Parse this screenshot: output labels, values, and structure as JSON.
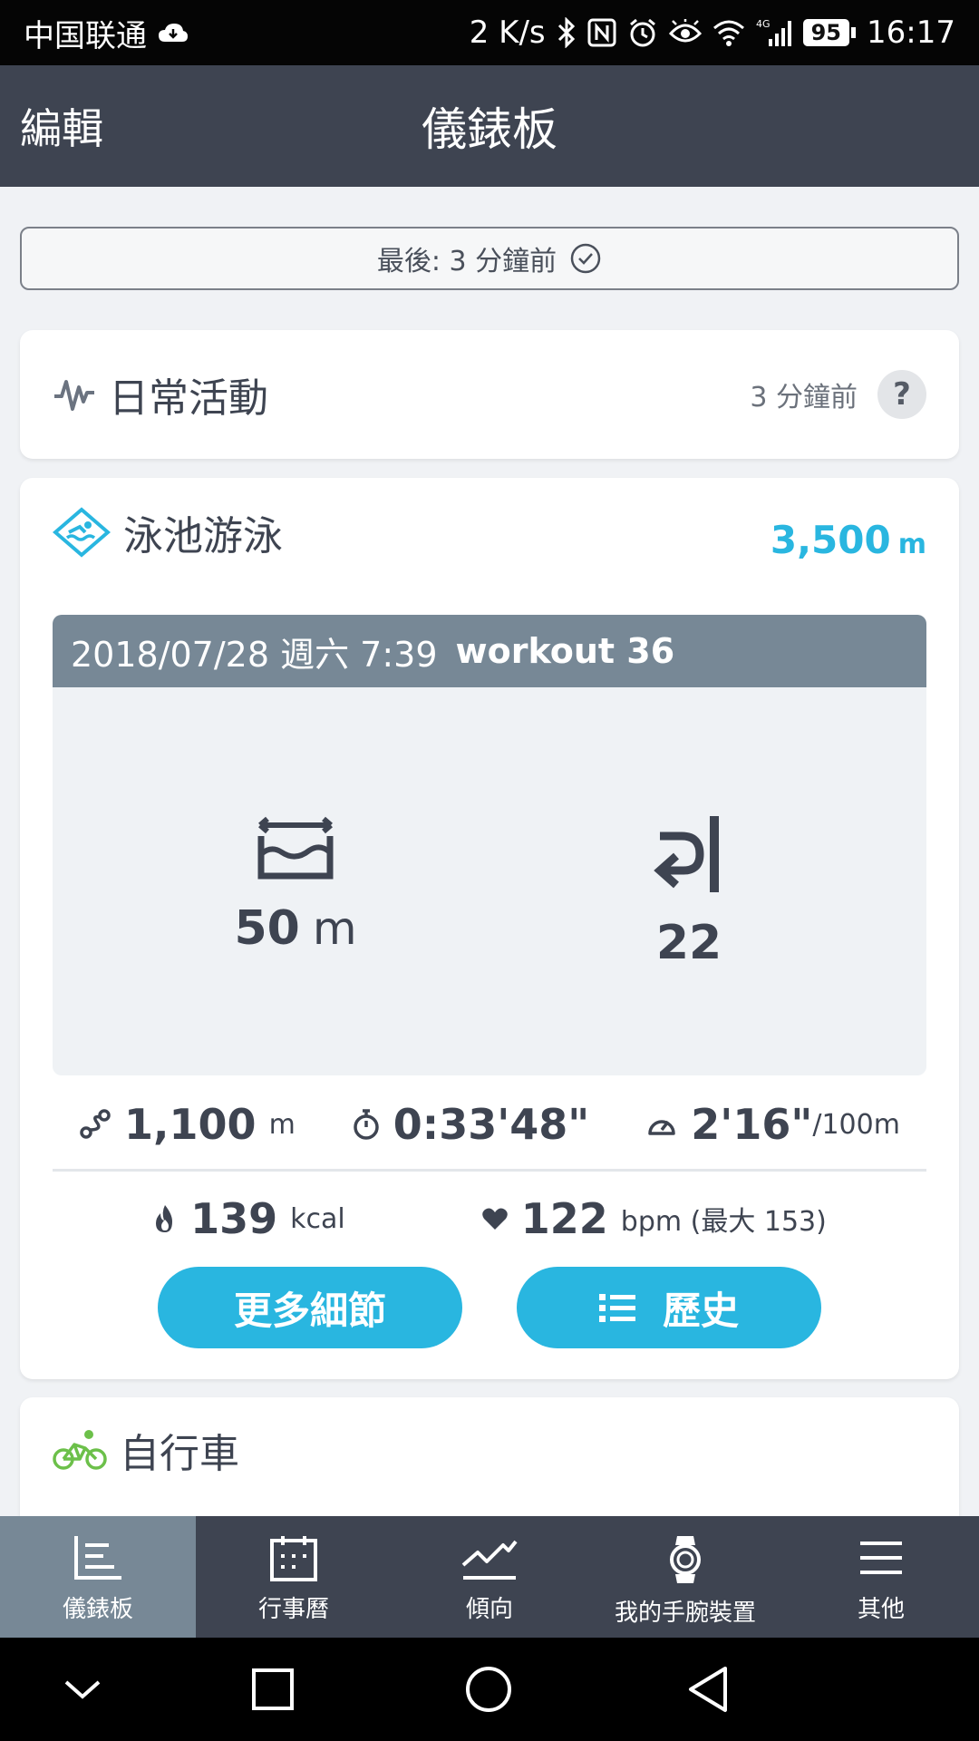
{
  "status_bar": {
    "carrier": "中国联通",
    "net_speed": "2 K/s",
    "network_type": "4G",
    "battery": "95",
    "time": "16:17"
  },
  "header": {
    "edit_label": "編輯",
    "title": "儀錶板"
  },
  "sync": {
    "label": "最後: 3 分鐘前",
    "icon": "check-circle-icon"
  },
  "daily_activity": {
    "title": "日常活動",
    "updated": "3 分鐘前",
    "help": "?",
    "icon": "activity-wave-icon"
  },
  "swim_card": {
    "title": "泳池游泳",
    "icon": "pool-swim-icon",
    "distance_value": "3,500",
    "distance_unit": "m",
    "workout": {
      "date": "2018/07/28 週六 7:39",
      "name": "workout 36",
      "pool_length_value": "50",
      "pool_length_unit": "m",
      "laps": "22"
    },
    "stats": {
      "distance_value": "1,100",
      "distance_unit": "m",
      "duration": "0:33'48\"",
      "pace_value": "2'16\"",
      "pace_unit": "/100m",
      "calories_value": "139",
      "calories_unit": "kcal",
      "heart_rate_value": "122",
      "heart_rate_unit": "bpm (最大 153)"
    },
    "more_button": "更多細節",
    "history_button": "歷史"
  },
  "bike_card": {
    "title": "自行車",
    "icon": "bicycle-icon"
  },
  "bottom_nav": [
    {
      "label": "儀錶板",
      "icon": "dashboard-icon",
      "active": true
    },
    {
      "label": "行事曆",
      "icon": "calendar-icon",
      "active": false
    },
    {
      "label": "傾向",
      "icon": "trend-icon",
      "active": false
    },
    {
      "label": "我的手腕裝置",
      "icon": "watch-icon",
      "active": false
    },
    {
      "label": "其他",
      "icon": "menu-icon",
      "active": false
    }
  ],
  "colors": {
    "header_bg": "#3e4451",
    "accent": "#29b6e0",
    "workout_header_bg": "#778896",
    "bike_green": "#6cc04a"
  }
}
